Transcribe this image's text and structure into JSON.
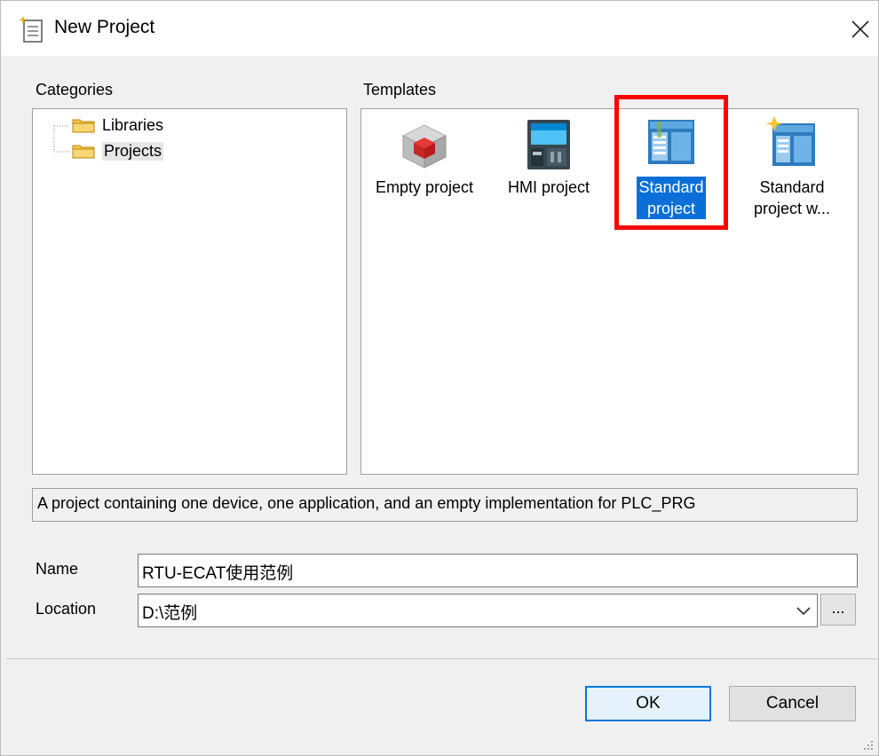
{
  "window": {
    "title": "New Project",
    "close_glyph": "✕"
  },
  "categories": {
    "label": "Categories",
    "items": [
      {
        "label": "Libraries",
        "icon": "folder-icon"
      },
      {
        "label": "Projects",
        "icon": "folder-icon",
        "selected": true
      }
    ]
  },
  "templates": {
    "label": "Templates",
    "items": [
      {
        "label": "Empty project",
        "icon": "empty-project-icon"
      },
      {
        "label": "HMI project",
        "icon": "hmi-project-icon"
      },
      {
        "label_line1": "Standard",
        "label_line2": "project",
        "icon": "standard-project-icon",
        "selected": true
      },
      {
        "label_line1": "Standard",
        "label_line2": "project w...",
        "icon": "standard-project-wizard-icon"
      }
    ]
  },
  "description": "A project containing one device, one application, and an empty implementation for PLC_PRG",
  "form": {
    "name_label": "Name",
    "name_value": "RTU-ECAT使用范例",
    "location_label": "Location",
    "location_value": "D:\\范例",
    "browse_label": "..."
  },
  "buttons": {
    "ok": "OK",
    "cancel": "Cancel"
  },
  "colors": {
    "highlight": "#ff0000",
    "selection": "#0a6fd8",
    "default_button_border": "#0078d7"
  }
}
